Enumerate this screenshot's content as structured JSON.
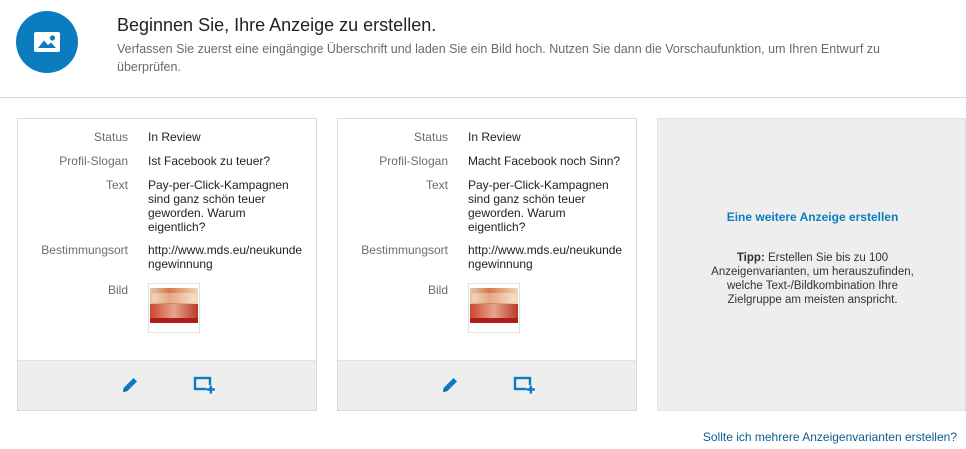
{
  "header": {
    "icon": "image-icon",
    "title": "Beginnen Sie, Ihre Anzeige zu erstellen.",
    "description": "Verfassen Sie zuerst eine eingängige Überschrift und laden Sie ein Bild hoch. Nutzen Sie dann die Vorschaufunktion, um Ihren Entwurf zu überprüfen."
  },
  "labels": {
    "status": "Status",
    "slogan": "Profil-Slogan",
    "text": "Text",
    "destination": "Bestimmungsort",
    "image": "Bild"
  },
  "ads": [
    {
      "status": "In Review",
      "slogan": "Ist Facebook zu teuer?",
      "text": "Pay-per-Click-Kampagnen sind ganz schön teuer geworden. Warum eigentlich?",
      "destination": "http://www.mds.eu/neukundengewinnung",
      "actions": [
        "pencil-icon",
        "duplicate-icon"
      ]
    },
    {
      "status": "In Review",
      "slogan": "Macht Facebook noch Sinn?",
      "text": "Pay-per-Click-Kampagnen sind ganz schön teuer geworden. Warum eigentlich?",
      "destination": "http://www.mds.eu/neukundengewinnung",
      "actions": [
        "pencil-icon",
        "duplicate-icon"
      ]
    }
  ],
  "add_panel": {
    "link": "Eine weitere Anzeige erstellen",
    "tip_label": "Tipp:",
    "tip_text": " Erstellen Sie bis zu 100 Anzeigenvarianten, um herauszufinden, welche Text-/Bildkombination Ihre Zielgruppe am meisten anspricht."
  },
  "footer_link": "Sollte ich mehrere Anzeigenvarianten erstellen?",
  "colors": {
    "accent": "#0b7dbf",
    "panel": "#eeeeee",
    "label": "#6b6b6b"
  }
}
